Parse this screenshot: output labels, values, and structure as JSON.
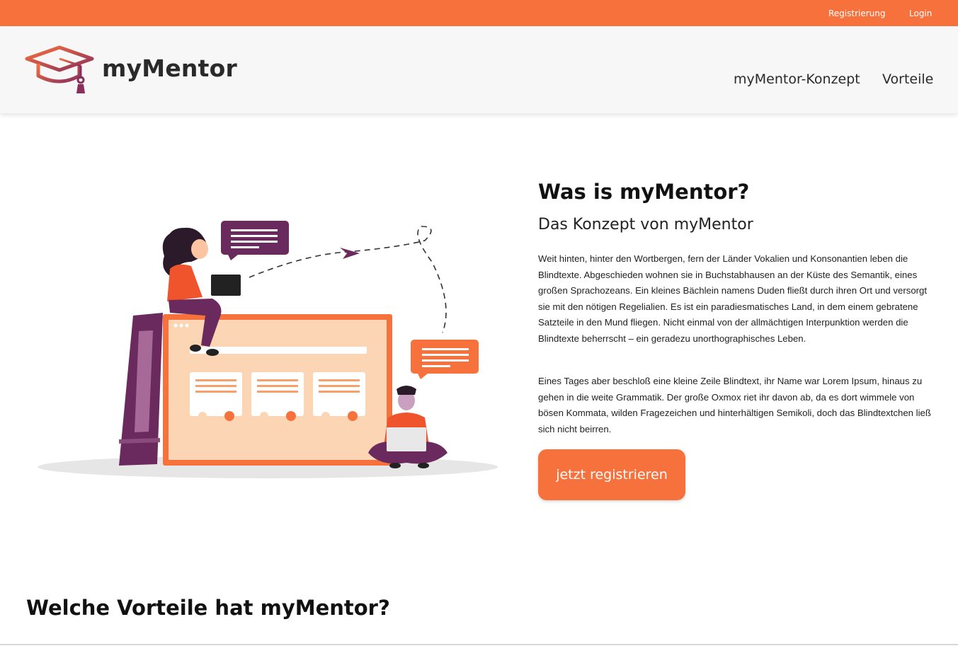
{
  "topbar": {
    "register_label": "Registrierung",
    "login_label": "Login",
    "color": "#f7713d"
  },
  "header": {
    "logo_text": "myMentor",
    "nav": [
      {
        "label": "myMentor-Konzept"
      },
      {
        "label": "Vorteile"
      }
    ]
  },
  "hero": {
    "title": "Was is myMentor?",
    "subtitle": "Das Konzept von myMentor",
    "paragraphs": [
      "Weit hinten, hinter den Wortbergen, fern der Länder Vokalien und Konsonantien leben die Blindtexte. Abgeschieden wohnen sie in Buchstabhausen an der Küste des Semantik, eines großen Sprachozeans. Ein kleines Bächlein namens Duden fließt durch ihren Ort und versorgt sie mit den nötigen Regelialien. Es ist ein paradiesmatisches Land, in dem einem gebratene Satzteile in den Mund fliegen. Nicht einmal von der allmächtigen Interpunktion werden die Blindtexte beherrscht – ein geradezu unorthographisches Leben.",
      "Eines Tages aber beschloß eine kleine Zeile Blindtext, ihr Name war Lorem Ipsum, hinaus zu gehen in die weite Grammatik. Der große Oxmox riet ihr davon ab, da es dort wimmele von bösen Kommata, wilden Fragezeichen und hinterhältigen Semikoli, doch das Blindtextchen ließ sich nicht beirren."
    ],
    "cta_label": "jetzt registrieren"
  },
  "benefits": {
    "title": "Welche Vorteile hat myMentor?"
  },
  "colors": {
    "accent": "#f7713d",
    "purple": "#6b2a5e",
    "peach": "#fccaa0"
  },
  "icons": [
    "graduation-cap-icon"
  ]
}
